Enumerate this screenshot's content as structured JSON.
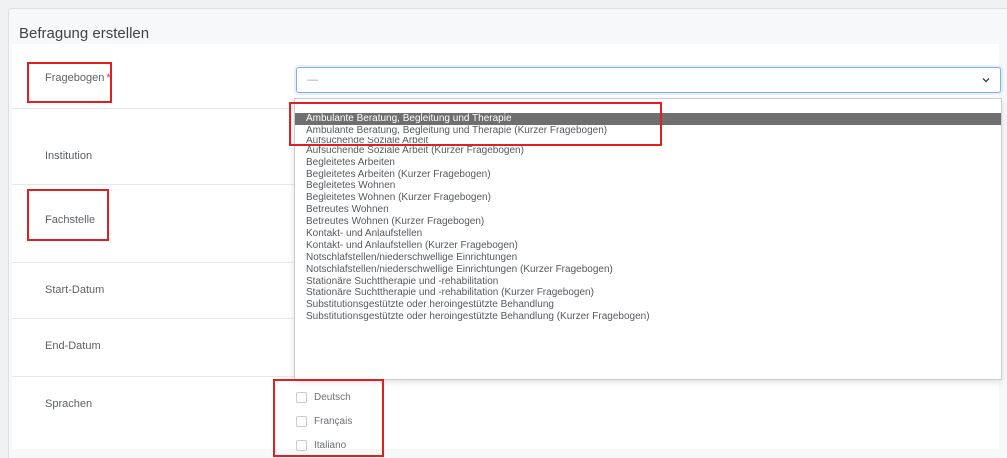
{
  "form": {
    "title": "Befragung erstellen",
    "fields": {
      "fragebogen": {
        "label": "Fragebogen",
        "required_marker": "*",
        "placeholder": "—"
      },
      "institution": {
        "label": "Institution"
      },
      "fachstelle": {
        "label": "Fachstelle"
      },
      "start_datum": {
        "label": "Start-Datum"
      },
      "end_datum": {
        "label": "End-Datum"
      },
      "sprachen": {
        "label": "Sprachen"
      }
    },
    "languages": [
      "Deutsch",
      "Français",
      "Italiano"
    ]
  },
  "dropdown": {
    "options": [
      "Ambulante Beratung, Begleitung und Therapie",
      "Ambulante Beratung, Begleitung und Therapie (Kurzer Fragebogen)",
      "Aufsuchende Soziale Arbeit",
      "Aufsuchende Soziale Arbeit (Kurzer Fragebogen)",
      "Begleitetes Arbeiten",
      "Begleitetes Arbeiten (Kurzer Fragebogen)",
      "Begleitetes Wohnen",
      "Begleitetes Wohnen (Kurzer Fragebogen)",
      "Betreutes Wohnen",
      "Betreutes Wohnen (Kurzer Fragebogen)",
      "Kontakt- und Anlaufstellen",
      "Kontakt- und Anlaufstellen (Kurzer Fragebogen)",
      "Notschlafstellen/niederschwellige Einrichtungen",
      "Notschlafstellen/niederschwellige Einrichtungen (Kurzer Fragebogen)",
      "Stationäre Suchttherapie und -rehabilitation",
      "Stationäre Suchttherapie und -rehabilitation (Kurzer Fragebogen)",
      "Substitutionsgestützte oder heroingestützte Behandlung",
      "Substitutionsgestützte oder heroingestützte Behandlung (Kurzer Fragebogen)"
    ],
    "highlighted_index": 0
  },
  "colors": {
    "highlight_box": "#e02020",
    "selected_option_bg": "#6f6f6f",
    "focus_border": "#7fb2e8"
  }
}
